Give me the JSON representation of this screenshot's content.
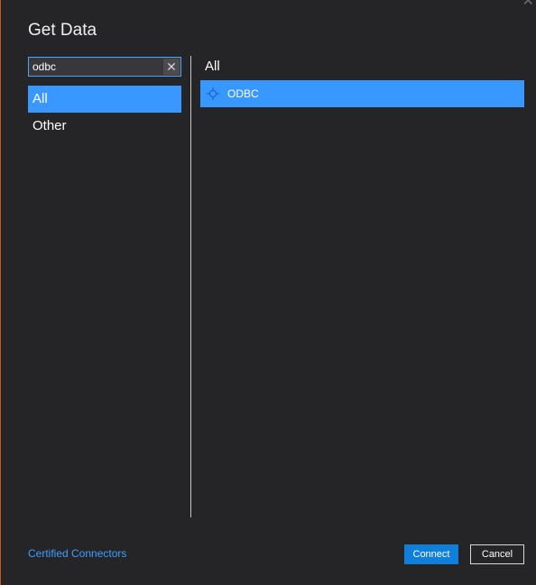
{
  "dialog": {
    "title": "Get Data",
    "close_glyph": "✕"
  },
  "search": {
    "value": "odbc",
    "placeholder": "",
    "clear_glyph": "✕"
  },
  "categories": [
    {
      "label": "All",
      "selected": true
    },
    {
      "label": "Other",
      "selected": false
    }
  ],
  "results": {
    "section_title": "All",
    "items": [
      {
        "label": "ODBC",
        "icon": "odbc-connector-icon",
        "selected": true
      }
    ]
  },
  "footer": {
    "link_label": "Certified Connectors",
    "connect_label": "Connect",
    "cancel_label": "Cancel"
  },
  "colors": {
    "background": "#252528",
    "accent": "#3898ff",
    "primary_button": "#0f7fd9",
    "link": "#3aa0ff"
  }
}
